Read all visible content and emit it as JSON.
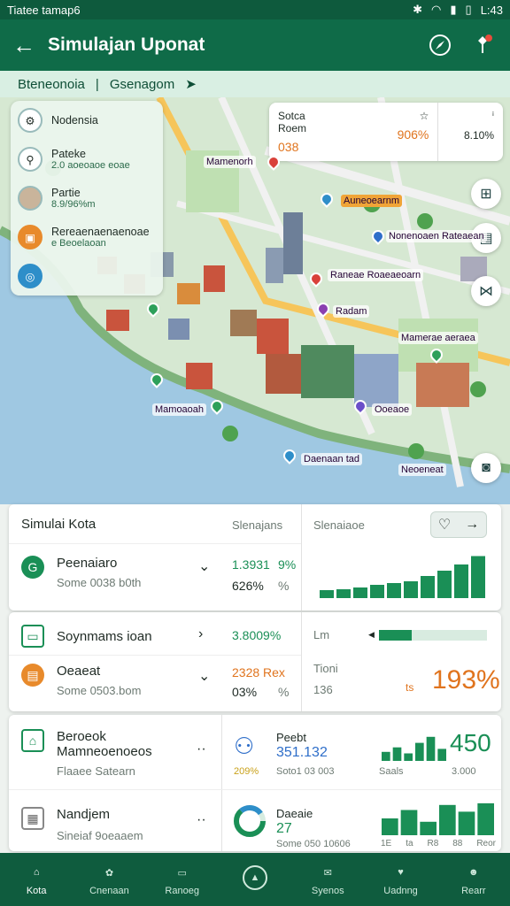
{
  "status_bar": {
    "left": "Tiatee tamap6",
    "time": "L:43"
  },
  "app_bar": {
    "title": "Simulajan Uponat"
  },
  "breadcrumb": {
    "first": "Bteneonoia",
    "separator": "|",
    "second": "Gsenagom"
  },
  "map": {
    "layers": [
      {
        "title": "Nodensia",
        "subtitle": ""
      },
      {
        "title": "Pateke",
        "subtitle": "2.0 aoeoaoe eoae"
      },
      {
        "title": "Partie",
        "subtitle": "8.9/96%m"
      },
      {
        "title": "Rereaenaenaenoae",
        "subtitle": "e Beoelaoan"
      }
    ],
    "stat_card": {
      "c1_title": "Sotca",
      "c1_sub": "Roem",
      "c1_val": "038",
      "c2_val": "906%",
      "c3_val": "8.10%"
    },
    "labels": {
      "l1": "Mamenorh",
      "l2": "Auneoearnm",
      "l3": "Nonenoaen Rateaean",
      "l4": "Raneae Roaeaeoarn",
      "l5": "Radam",
      "l6": "Mamerae aeraea",
      "l7": "Mamoaoah",
      "l8": "Ooeaoe",
      "l9": "Daenaan tad",
      "l10": "Neoeneat"
    }
  },
  "panel1": {
    "title": "Simulai Kota",
    "col2": "Slenajans",
    "col3": "Slenaiaoe",
    "row_title": "Peenaiaro",
    "row_sub": "Some 0038 b0th",
    "v1": "1.3931",
    "v2": "9%",
    "v3": "626%",
    "v4": "%",
    "bars": [
      0.18,
      0.2,
      0.24,
      0.3,
      0.34,
      0.38,
      0.5,
      0.62,
      0.76,
      0.95
    ]
  },
  "panel2": {
    "r1_title": "Soynmams ioan",
    "r1_val": "3.8009%",
    "r2_title": "Oeaeat",
    "r2_sub": "Some 0503.bom",
    "r2_v1": "2328 Rex",
    "r2_v2": "03%",
    "r2_v3": "%",
    "right_label": "Lm",
    "right_label2": "Tioni",
    "right_sub": "136",
    "right_small": "ts",
    "big": "193%",
    "fill": 0.3
  },
  "panel3": {
    "a_title": "Beroeok Mamneoenoeos",
    "a_sub": "Flaaee Satearn",
    "b_title": "Peebt",
    "b_val": "351.132",
    "b_pct": "209%",
    "b_sub": "Soto1 03 003",
    "b_big": "450",
    "b_lbl": "Saals",
    "b_lbl2": "3.000",
    "c_title": "Nandjem",
    "c_sub": "Sineiaf 9oeaaem",
    "d_title": "Daeaie",
    "d_val": "27",
    "d_sub": "Some 050 10606",
    "d_ticks": [
      "1E",
      "ta",
      "R8",
      "88",
      "Reor"
    ],
    "bars_b": [
      0.3,
      0.45,
      0.25,
      0.6,
      0.8,
      0.4
    ],
    "bars_d": [
      0.5,
      0.75,
      0.4,
      0.9,
      0.7,
      0.95
    ]
  },
  "tabs": [
    "Kota",
    "Cnenaan",
    "Ranoeg",
    "",
    "Syenos",
    "Uadnng",
    "Rearr"
  ]
}
